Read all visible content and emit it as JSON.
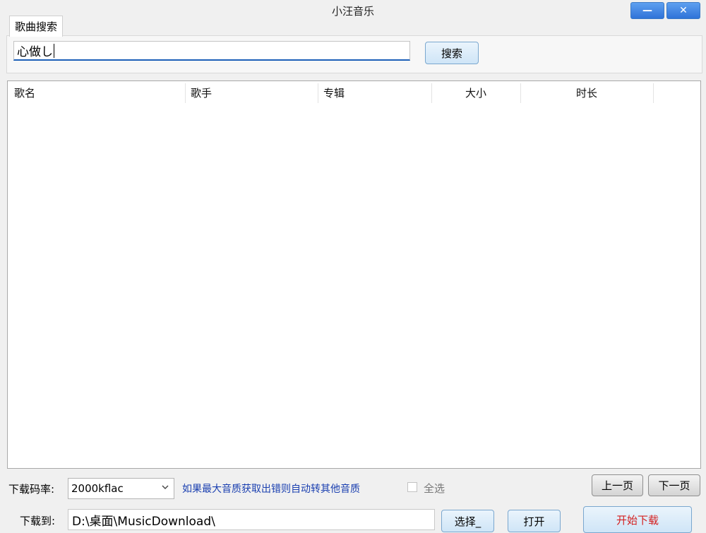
{
  "window": {
    "title": "小汪音乐",
    "minimize_label": "—",
    "close_label": "✕"
  },
  "tabs": [
    {
      "label": "歌曲搜索"
    }
  ],
  "search": {
    "value": "心做し",
    "button_label": "搜索"
  },
  "table": {
    "columns": [
      "歌名",
      "歌手",
      "专辑",
      "大小",
      "时长"
    ],
    "rows": []
  },
  "bottom": {
    "bitrate_label": "下载码率:",
    "bitrate_value": "2000kflac",
    "hint": "如果最大音质获取出错则自动转其他音质",
    "select_all_label": "全选",
    "prev_page_label": "上一页",
    "next_page_label": "下一页",
    "download_to_label": "下载到:",
    "download_path": "D:\\桌面\\MusicDownload\\",
    "choose_label": "选择_",
    "open_label": "打开",
    "start_label": "开始下载"
  },
  "colors": {
    "accent": "#1c5fb8",
    "hint_text": "#1a3fb0",
    "start_text": "#d42020"
  }
}
